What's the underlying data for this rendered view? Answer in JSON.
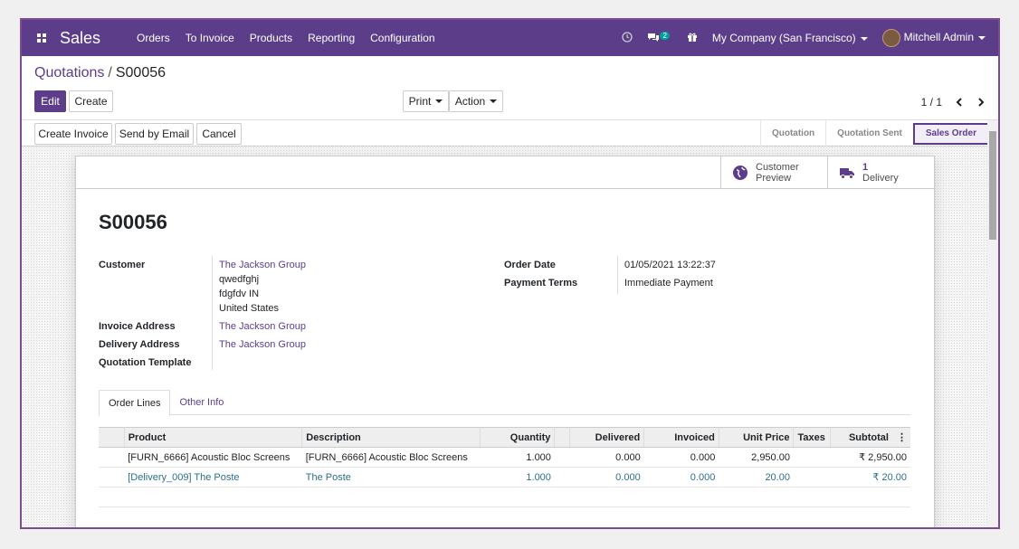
{
  "navbar": {
    "app_name": "Sales",
    "menu": [
      "Orders",
      "To Invoice",
      "Products",
      "Reporting",
      "Configuration"
    ],
    "messages_count": "2",
    "company": "My Company (San Francisco)",
    "user": "Mitchell Admin"
  },
  "breadcrumb": {
    "parent": "Quotations",
    "separator": "/",
    "current": "S00056"
  },
  "toolbar": {
    "edit": "Edit",
    "create": "Create",
    "print": "Print",
    "action": "Action",
    "pager": "1 / 1"
  },
  "actions": {
    "create_invoice": "Create Invoice",
    "send_email": "Send by Email",
    "cancel": "Cancel"
  },
  "stages": {
    "quotation": "Quotation",
    "sent": "Quotation Sent",
    "sales_order": "Sales Order"
  },
  "smart_buttons": {
    "preview_line1": "Customer",
    "preview_line2": "Preview",
    "delivery_count": "1",
    "delivery_label": "Delivery"
  },
  "order": {
    "name": "S00056",
    "customer_label": "Customer",
    "customer": "The Jackson Group",
    "addr1": "qwedfghj",
    "addr2": "fdgfdv IN",
    "addr3": "United States",
    "invoice_label": "Invoice Address",
    "invoice_address": "The Jackson Group",
    "delivery_label": "Delivery Address",
    "delivery_address": "The Jackson Group",
    "template_label": "Quotation Template",
    "date_label": "Order Date",
    "date": "01/05/2021 13:22:37",
    "terms_label": "Payment Terms",
    "terms": "Immediate Payment"
  },
  "tabs": {
    "lines": "Order Lines",
    "other": "Other Info"
  },
  "columns": [
    "Product",
    "Description",
    "Quantity",
    "Delivered",
    "Invoiced",
    "Unit Price",
    "Taxes",
    "Subtotal"
  ],
  "lines": [
    {
      "product": "[FURN_6666] Acoustic Bloc Screens",
      "description": "[FURN_6666] Acoustic Bloc Screens",
      "qty": "1.000",
      "delivered": "0.000",
      "invoiced": "0.000",
      "price": "2,950.00",
      "taxes": "",
      "subtotal": "₹ 2,950.00"
    },
    {
      "product": "[Delivery_009] The Poste",
      "description": "The Poste",
      "qty": "1.000",
      "delivered": "0.000",
      "invoiced": "0.000",
      "price": "20.00",
      "taxes": "",
      "subtotal": "₹ 20.00"
    }
  ]
}
